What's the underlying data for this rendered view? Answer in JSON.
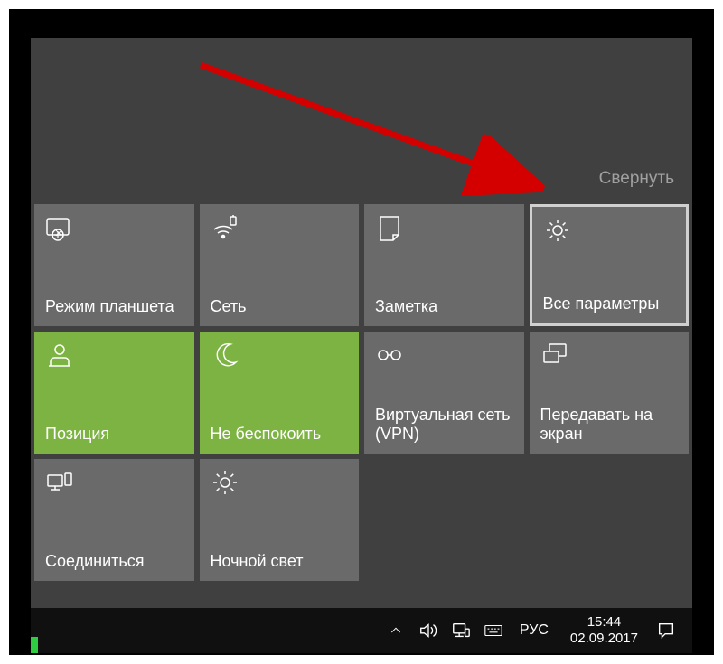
{
  "collapse_label": "Свернуть",
  "tiles": [
    {
      "id": "tablet-mode",
      "label": "Режим планшета",
      "icon": "tablet",
      "active": false
    },
    {
      "id": "network",
      "label": "Сеть",
      "icon": "wifi",
      "active": false
    },
    {
      "id": "note",
      "label": "Заметка",
      "icon": "note",
      "active": false
    },
    {
      "id": "all-settings",
      "label": "Все параметры",
      "icon": "gear",
      "active": false,
      "highlighted": true
    },
    {
      "id": "location",
      "label": "Позиция",
      "icon": "location",
      "active": true
    },
    {
      "id": "quiet-hours",
      "label": "Не беспокоить",
      "icon": "moon",
      "active": true
    },
    {
      "id": "vpn",
      "label": "Виртуальная сеть (VPN)",
      "icon": "vpn",
      "active": false
    },
    {
      "id": "project",
      "label": "Передавать на экран",
      "icon": "project",
      "active": false
    },
    {
      "id": "connect",
      "label": "Соединиться",
      "icon": "connect",
      "active": false
    },
    {
      "id": "night-light",
      "label": "Ночной свет",
      "icon": "sun",
      "active": false
    }
  ],
  "taskbar": {
    "lang": "РУС",
    "time": "15:44",
    "date": "02.09.2017"
  }
}
